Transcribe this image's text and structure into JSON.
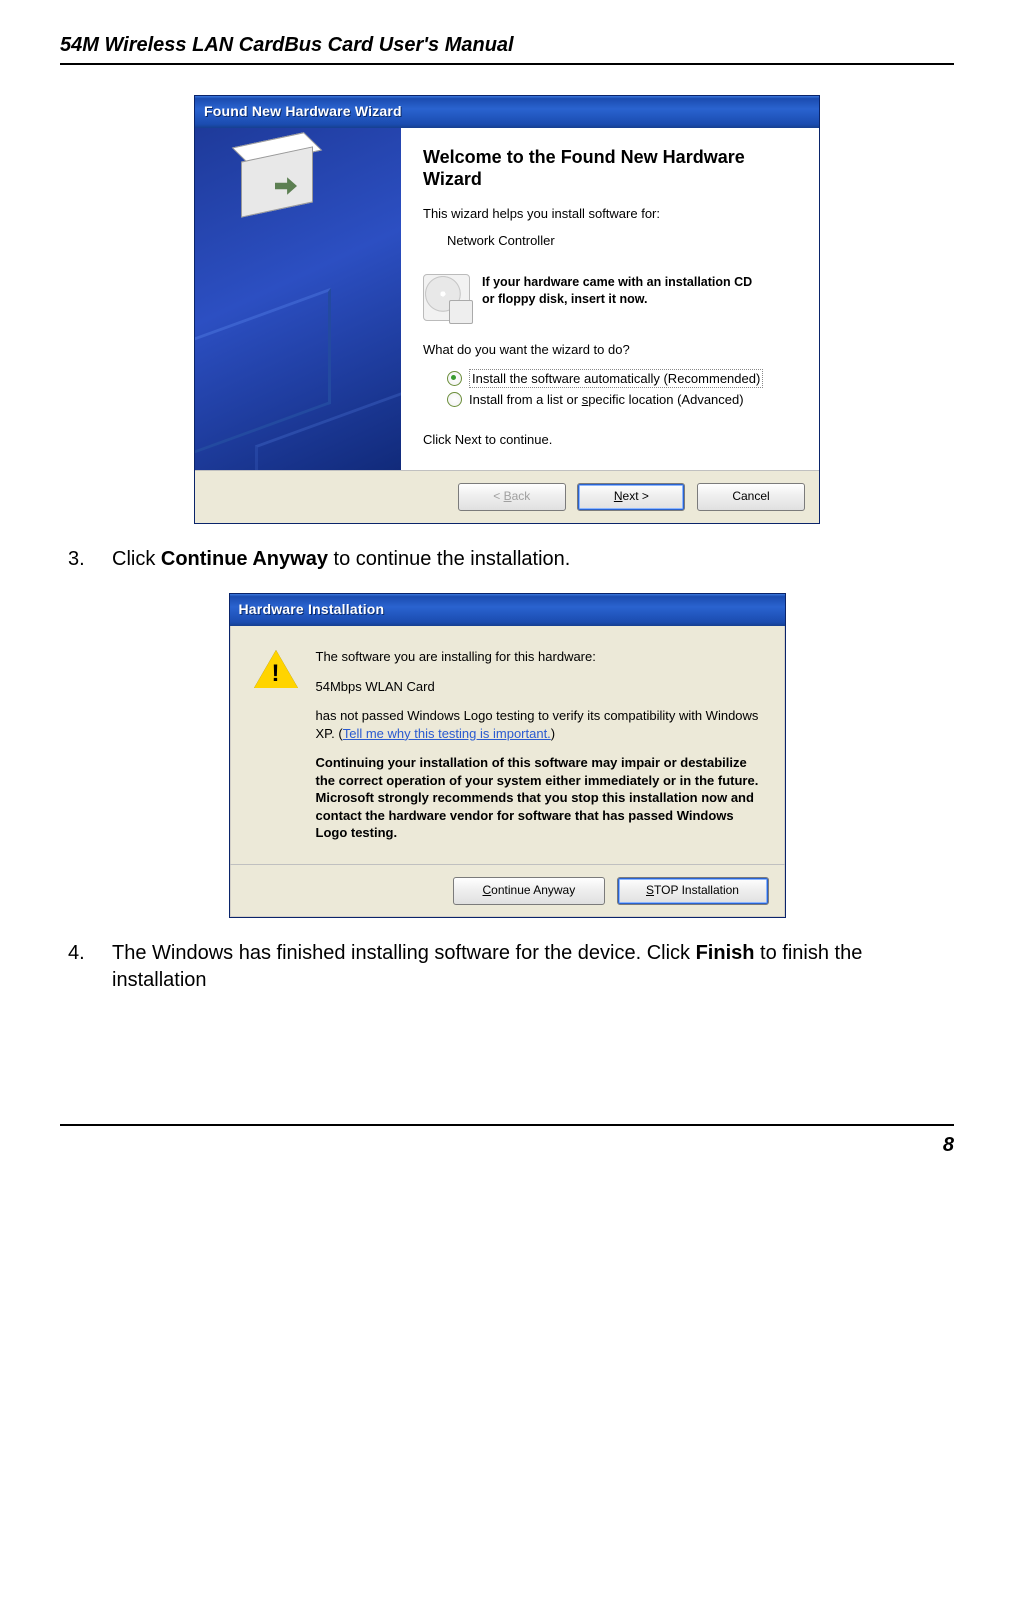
{
  "doc": {
    "header": "54M Wireless LAN CardBus Card User's Manual",
    "page_number": "8"
  },
  "wizard1": {
    "title": "Found New Hardware Wizard",
    "heading": "Welcome to the Found New Hardware Wizard",
    "intro": "This wizard helps you install software for:",
    "device": "Network Controller",
    "cd_line1": "If your hardware came with an installation CD",
    "cd_line2": "or floppy disk, insert it now.",
    "question": "What do you want the wizard to do?",
    "option1_pre": "Install the software automatically (Recommended)",
    "option2_before_s": "Install from a list or ",
    "option2_s": "s",
    "option2_after_s": "pecific location (Advanced)",
    "continue_line": "Click Next to continue.",
    "back_b": "B",
    "back_rest": "ack",
    "next_n": "N",
    "next_rest": "ext >",
    "cancel": "Cancel"
  },
  "step3": {
    "num": "3.",
    "before": "Click ",
    "bold": "Continue Anyway",
    "after": " to continue the installation."
  },
  "dialog2": {
    "title": "Hardware Installation",
    "line1": "The software you are installing for this hardware:",
    "device": "54Mbps WLAN Card",
    "compat1": "has not passed Windows Logo testing to verify its compatibility with Windows XP. (",
    "compat_link": "Tell me why this testing is important.",
    "compat2": ")",
    "warn": "Continuing your installation of this software may impair or destabilize the correct operation of your system either immediately or in the future. Microsoft strongly recommends that you stop this installation now and contact the hardware vendor for software that has passed Windows Logo testing.",
    "btn_cont_c": "C",
    "btn_cont_rest": "ontinue Anyway",
    "btn_stop_s": "S",
    "btn_stop_rest": "TOP Installation"
  },
  "step4": {
    "num": "4.",
    "before": "The Windows has finished installing software for the device. Click ",
    "bold": "Finish",
    "after": " to finish the installation"
  }
}
